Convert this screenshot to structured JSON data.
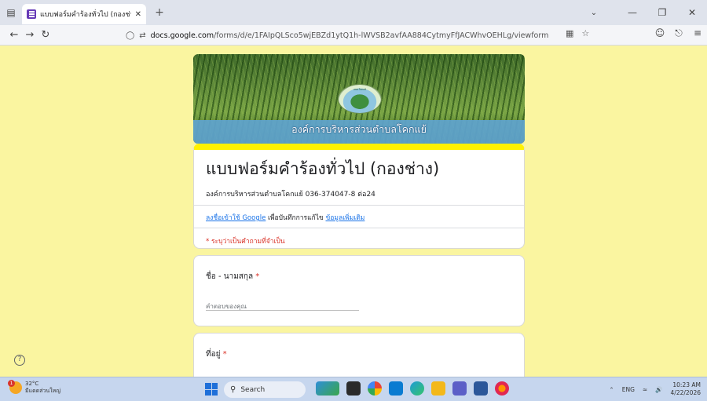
{
  "browser": {
    "tab_title": "แบบฟอร์มคำร้องทั่วไป (กองช่าง)",
    "tab_close": "✕",
    "new_tab": "+",
    "url_domain": "docs.google.com",
    "url_path": "/forms/d/e/1FAIpQLSco5wjEBZd1ytQ1h-lWVSB2avfAA884CytmyFfJACWhvOEHLg/viewform",
    "icons": {
      "tab_list": "tab-list-icon",
      "back": "back-arrow-icon",
      "forward": "forward-arrow-icon",
      "reload": "reload-icon",
      "shield": "tracking-shield-icon",
      "permissions": "permissions-icon",
      "reader": "reader-view-icon",
      "bookmark": "bookmark-star-icon",
      "account": "account-icon",
      "extensions": "extensions-icon",
      "menu": "menu-icon"
    }
  },
  "banner": {
    "title": "องค์การบริหารส่วนตำบลโคกแย้",
    "subtitle": "",
    "seal_text": "อบต.โคกแย้"
  },
  "form": {
    "title": "แบบฟอร์มคำร้องทั่วไป (กองช่าง)",
    "description": "องค์การบริหารส่วนตำบลโคกแย้  036-374047-8 ต่อ24",
    "signin_link": "ลงชื่อเข้าใช้ Google",
    "signin_text": " เพื่อบันทึกการแก้ไข ",
    "more_info_link": "ข้อมูลเพิ่มเติม",
    "required_note": "* ระบุว่าเป็นคำถามที่จำเป็น",
    "accent_color": "#fff200",
    "background_color": "#faf5a0",
    "questions": [
      {
        "title": "ชื่อ - นามสกุล",
        "required_mark": "*",
        "placeholder": "คำตอบของคุณ"
      },
      {
        "title": "ที่อยู่",
        "required_mark": "*"
      }
    ],
    "help_label": "?"
  },
  "taskbar": {
    "weather_temp": "32°C",
    "weather_desc": "มีแดดส่วนใหญ่",
    "weather_badge": "1",
    "search_label": "Search",
    "language": "ENG",
    "time": "10:23 AM",
    "date": "4/22/2026"
  }
}
